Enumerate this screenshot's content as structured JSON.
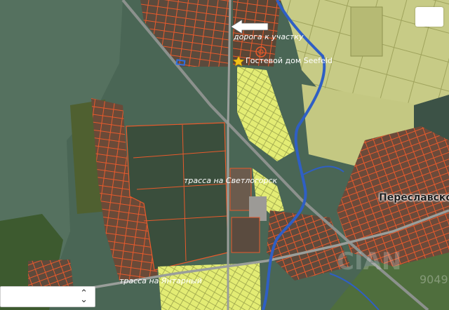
{
  "map": {
    "labels": {
      "road_to_plot": "дорога к участку",
      "guest_house": "Гостевой дом Seefeld",
      "svetlogorsk_route": "трасса на Светлогорск",
      "pereslavskoe": "Переславское",
      "yantarny_route": "трасса на Янтарный"
    },
    "watermark": "9049",
    "icons": {
      "arrow": "left-arrow-icon",
      "star": "star-icon",
      "chevron": "chevron-up-down-icon"
    },
    "colors": {
      "forest": "#3f5a4c",
      "dark_forest": "#2e4434",
      "field": "#c9cc88",
      "plot_outline": "#e85a2c",
      "plot_fill_light": "#e9f27a",
      "water": "#2f5fc4",
      "road": "#8a8f8c"
    }
  }
}
